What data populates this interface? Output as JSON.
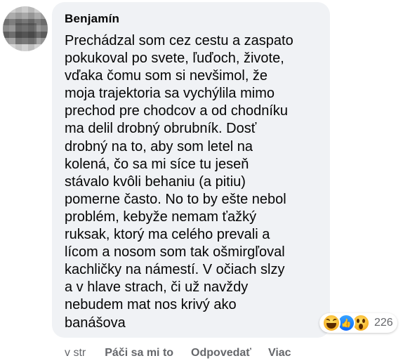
{
  "comment": {
    "author": "Benjamín",
    "text_lines": [
      "Prechádzal som cez cestu a zaspato",
      "pokukoval po svete, ľuďoch, živote,",
      "vďaka čomu som si nevšimol, že",
      "moja trajektoria sa vychýlila mimo",
      "prechod pre chodcov a od chodníku",
      "ma delil drobný obrubník. Dosť",
      "drobný na to, aby som letel na",
      "kolená, čo sa mi síce tu jeseň",
      "stávalo kvôli behaniu (a pitiu)",
      "pomerne často. No to by ešte nebol",
      "problém, kebyže nemam ťažký",
      "ruksak, ktorý ma celého prevali a",
      "lícom a nosom som tak ošmirgľoval",
      "kachličky na námestí. V očiach slzy",
      "a v hlave strach, či už navždy",
      "nebudem mat nos krivý ako",
      "banášova"
    ],
    "reactions": {
      "icons": [
        "haha-icon",
        "like-icon",
        "wow-icon"
      ],
      "count": "226"
    },
    "actions": {
      "timestamp": "v str",
      "like_label": "Páči sa mi to",
      "reply_label": "Odpovedať",
      "more_label": "Viac"
    }
  },
  "colors": {
    "bubble_background": "#f0f2f5",
    "text": "#050505",
    "secondary_text": "#65676b",
    "like_blue": "#0866ff",
    "reaction_yellow": "#f7b125"
  }
}
